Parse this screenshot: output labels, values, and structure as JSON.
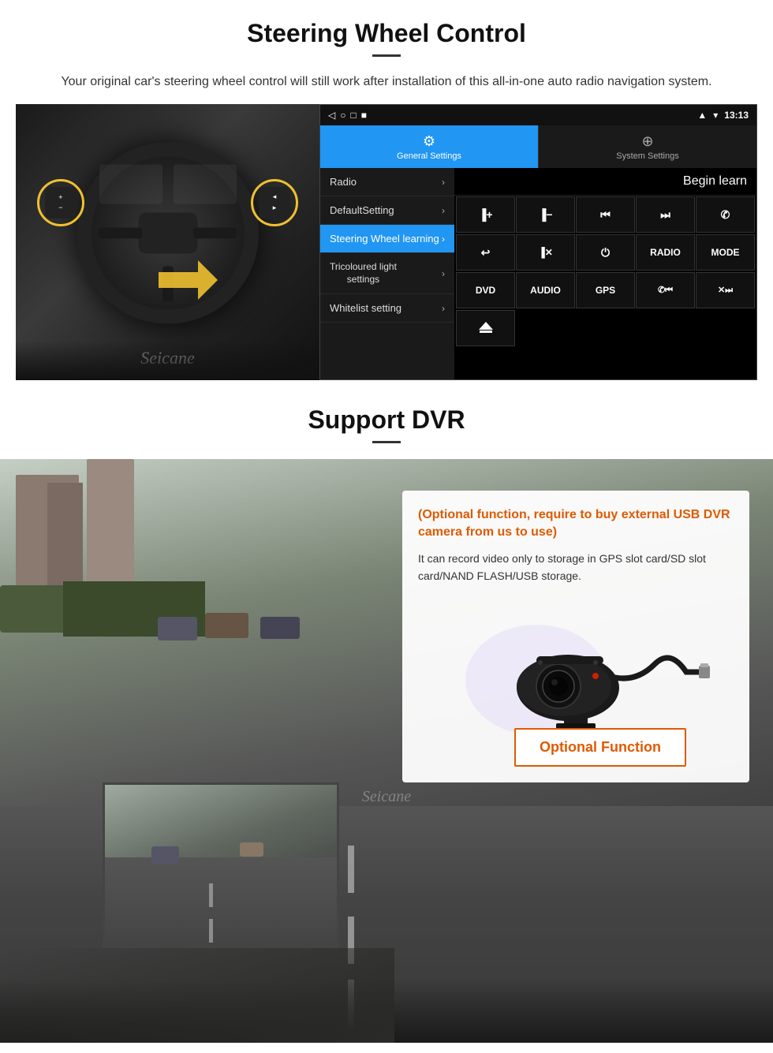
{
  "section1": {
    "title": "Steering Wheel Control",
    "subtitle": "Your original car's steering wheel control will still work after installation of this all-in-one auto radio navigation system.",
    "seicane_watermark": "Seicane"
  },
  "android_ui": {
    "status_bar": {
      "signal_icon": "▲▼",
      "wifi_icon": "▾",
      "time": "13:13",
      "battery_icon": "▮"
    },
    "nav_bar": {
      "back": "◁",
      "home": "○",
      "recent": "□",
      "menu": "■"
    },
    "tabs": {
      "general": {
        "icon": "⚙",
        "label": "General Settings"
      },
      "system": {
        "icon": "⊕",
        "label": "System Settings"
      }
    },
    "menu_items": [
      {
        "label": "Radio",
        "active": false
      },
      {
        "label": "DefaultSetting",
        "active": false
      },
      {
        "label": "Steering Wheel learning",
        "active": true
      },
      {
        "label": "Tricoloured light\nsettings",
        "active": false
      },
      {
        "label": "Whitelist setting",
        "active": false
      }
    ],
    "begin_learn_label": "Begin learn",
    "controls": [
      {
        "label": "▐+",
        "row": 1
      },
      {
        "label": "▐-",
        "row": 1
      },
      {
        "label": "⏮",
        "row": 1
      },
      {
        "label": "⏭",
        "row": 1
      },
      {
        "label": "✆",
        "row": 1
      },
      {
        "label": "↩",
        "row": 2
      },
      {
        "label": "✕",
        "row": 2
      },
      {
        "label": "⏻",
        "row": 2
      },
      {
        "label": "RADIO",
        "row": 2
      },
      {
        "label": "MODE",
        "row": 2
      },
      {
        "label": "DVD",
        "row": 3
      },
      {
        "label": "AUDIO",
        "row": 3
      },
      {
        "label": "GPS",
        "row": 3
      },
      {
        "label": "✆⏮",
        "row": 3
      },
      {
        "label": "✕⏭",
        "row": 3
      },
      {
        "label": "⏏",
        "row": 4
      }
    ]
  },
  "section2": {
    "title": "Support DVR",
    "title_divider": true,
    "card": {
      "optional_text": "(Optional function, require to buy external USB DVR camera from us to use)",
      "desc_text": "It can record video only to storage in GPS slot card/SD slot card/NAND FLASH/USB storage.",
      "optional_function_label": "Optional Function"
    }
  }
}
